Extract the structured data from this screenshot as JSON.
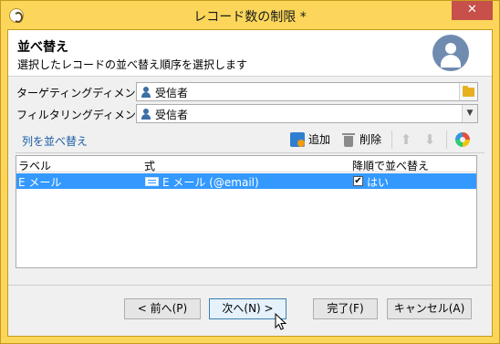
{
  "window": {
    "title": "レコード数の制限 *",
    "close_glyph": "✕"
  },
  "header": {
    "title": "並べ替え",
    "subtitle": "選択したレコードの並べ替え順序を選択します"
  },
  "fields": {
    "targeting_label": "ターゲティングディメンション:",
    "targeting_value": "受信者",
    "filtering_label": "フィルタリングディメンション:",
    "filtering_value": "受信者"
  },
  "toolbar": {
    "sort_link": "列を並べ替え",
    "add_label": "追加",
    "delete_label": "削除",
    "up_glyph": "⬆",
    "down_glyph": "⬇"
  },
  "grid": {
    "columns": [
      "ラベル",
      "式",
      "降順で並べ替え"
    ],
    "rows": [
      {
        "label": "E メール",
        "expression": "E メール (@email)",
        "descending_check": "✔",
        "descending": "はい"
      }
    ]
  },
  "buttons": {
    "prev": "< 前へ(P)",
    "next": "次へ(N) >",
    "finish": "完了(F)",
    "cancel": "キャンセル(A)"
  },
  "colors": {
    "title_bar": "#fbd65a",
    "close_button": "#c7504b",
    "selection": "#3399ff",
    "link": "#1a5fa8"
  }
}
